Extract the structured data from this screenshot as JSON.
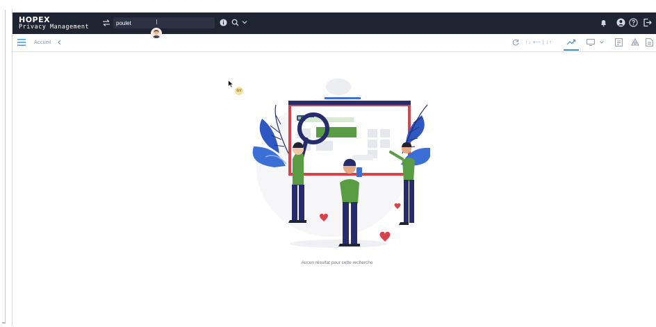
{
  "header": {
    "logo_title": "HOPEX",
    "logo_subtitle": "Privacy Management",
    "search": {
      "value": "poulet",
      "placeholder": ""
    }
  },
  "toolbar": {
    "breadcrumb": "Accueil",
    "filter_text": "↑↓ ⟵ | ↓↑"
  },
  "main": {
    "empty_message": "Aucun résultat pour cette recherche",
    "user_badge": "GV"
  },
  "colors": {
    "topbar_bg": "#1f2433",
    "accent_blue": "#3b8fd6",
    "illustration_navy": "#252b6b",
    "illustration_red": "#d8434b",
    "illustration_green": "#5a9c43"
  },
  "icons": [
    "swap-icon",
    "text-cursor-icon",
    "info-icon",
    "search-icon",
    "chevron-down-icon",
    "bell-icon",
    "user-icon",
    "help-icon",
    "logout-icon",
    "menu-icon",
    "back-icon",
    "refresh-icon",
    "trend-icon",
    "screen-icon",
    "report-icon",
    "print-icon",
    "doc-icon",
    "mouse-cursor-icon"
  ]
}
